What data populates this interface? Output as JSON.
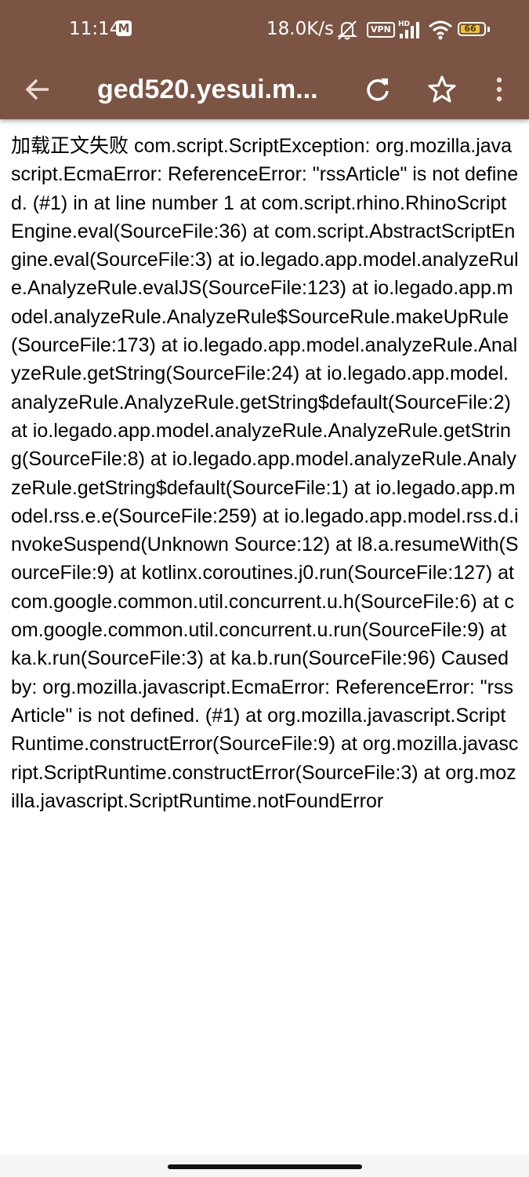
{
  "status_bar": {
    "time": "11:14",
    "mail_badge": "M",
    "net_speed": "18.0K/s",
    "vpn": "VPN",
    "battery": "66",
    "icons": [
      "mute-bell-icon",
      "vpn-icon",
      "hd-signal-icon",
      "wifi-icon",
      "battery-icon"
    ]
  },
  "toolbar": {
    "title": "ged520.yesui.m...",
    "icons": [
      "back-arrow-icon",
      "refresh-icon",
      "star-icon",
      "more-vert-icon"
    ]
  },
  "article": {
    "text": "加载正文失败 com.script.ScriptException: org.mozilla.javascript.EcmaError: ReferenceError: \"rssArticle\" is not defined. (#1) in at line number 1 at com.script.rhino.RhinoScriptEngine.eval(SourceFile:36) at com.script.AbstractScriptEngine.eval(SourceFile:3) at io.legado.app.model.analyzeRule.AnalyzeRule.evalJS(SourceFile:123) at io.legado.app.model.analyzeRule.AnalyzeRule$SourceRule.makeUpRule(SourceFile:173) at io.legado.app.model.analyzeRule.AnalyzeRule.getString(SourceFile:24) at io.legado.app.model.analyzeRule.AnalyzeRule.getString$default(SourceFile:2) at io.legado.app.model.analyzeRule.AnalyzeRule.getString(SourceFile:8) at io.legado.app.model.analyzeRule.AnalyzeRule.getString$default(SourceFile:1) at io.legado.app.model.rss.e.e(SourceFile:259) at io.legado.app.model.rss.d.invokeSuspend(Unknown Source:12) at l8.a.resumeWith(SourceFile:9) at kotlinx.coroutines.j0.run(SourceFile:127) at com.google.common.util.concurrent.u.h(SourceFile:6) at com.google.common.util.concurrent.u.run(SourceFile:9) at ka.k.run(SourceFile:3) at ka.b.run(SourceFile:96) Caused by: org.mozilla.javascript.EcmaError: ReferenceError: \"rssArticle\" is not defined. (#1) at org.mozilla.javascript.ScriptRuntime.constructError(SourceFile:9) at org.mozilla.javascript.ScriptRuntime.constructError(SourceFile:3) at org.mozilla.javascript.ScriptRuntime.notFoundError"
  },
  "colors": {
    "appbar": "#7b5443",
    "content_bg": "#ffffff",
    "text": "#000000",
    "battery": "#f2c230"
  }
}
